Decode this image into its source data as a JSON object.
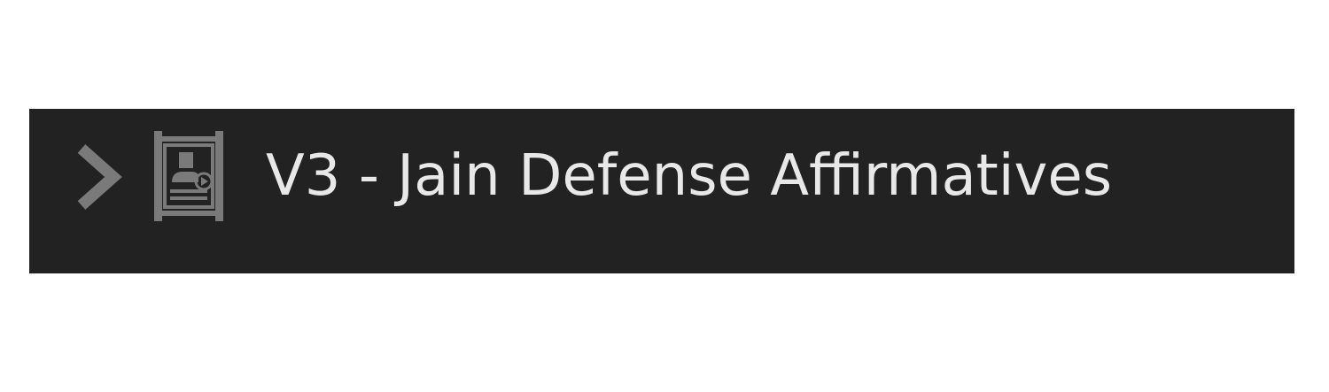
{
  "tree_item": {
    "label": "V3 - Jain Defense Affirmatives",
    "expanded": false,
    "chevron_icon": "chevron-right-icon",
    "item_icon": "presentation-video-icon"
  },
  "colors": {
    "row_background": "#222222",
    "label_text": "#e8e8e8",
    "icon_gray": "#7a7a7a",
    "page_background": "#ffffff"
  }
}
